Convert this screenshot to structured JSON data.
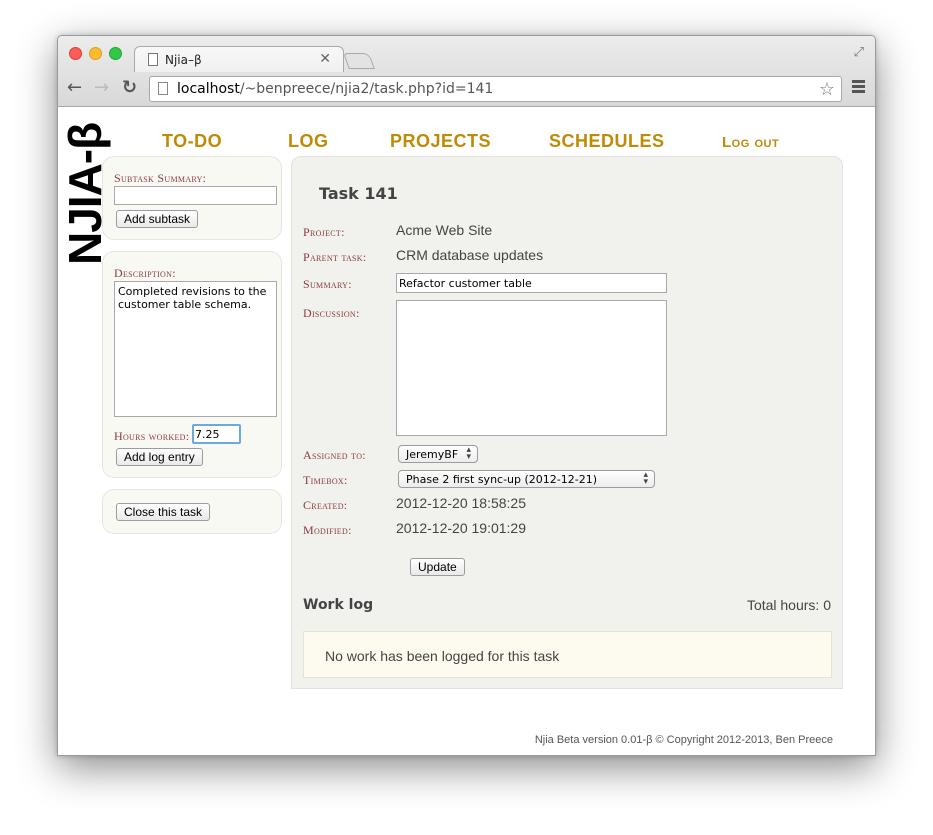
{
  "browser": {
    "tab_title": "Njia–β",
    "tab_close": "✕",
    "url_host": "localhost",
    "url_path": "/~benpreece/njia2/task.php?id=141"
  },
  "logo": {
    "text": "NJIA-β"
  },
  "nav": {
    "todo": "TO-DO",
    "log": "LOG",
    "projects": "PROJECTS",
    "schedules": "SCHEDULES",
    "logout": "Log out"
  },
  "subtask": {
    "label": "Subtask Summary:",
    "value": "",
    "add_button": "Add subtask"
  },
  "log_entry": {
    "description_label": "Description:",
    "description_value": "Completed revisions to the customer table schema.",
    "hours_label": "Hours worked:",
    "hours_value": "7.25",
    "add_button": "Add log entry"
  },
  "close_task": {
    "button": "Close this task"
  },
  "task": {
    "title": "Task 141",
    "project_label": "Project:",
    "project_value": "Acme Web Site",
    "parent_label": "Parent task:",
    "parent_value": "CRM database updates",
    "summary_label": "Summary:",
    "summary_value": "Refactor customer table",
    "discussion_label": "Discussion:",
    "discussion_value": "",
    "assigned_label": "Assigned to:",
    "assigned_value": "JeremyBF",
    "timebox_label": "Timebox:",
    "timebox_value": "Phase 2 first sync-up (2012-12-21)",
    "created_label": "Created:",
    "created_value": "2012-12-20 18:58:25",
    "modified_label": "Modified:",
    "modified_value": "2012-12-20 19:01:29",
    "update_button": "Update"
  },
  "worklog": {
    "title": "Work log",
    "total_hours": "Total hours: 0",
    "empty_message": "No work has been logged for this task"
  },
  "footer": {
    "text": "Njia Beta version 0.01-β © Copyright 2012-2013, Ben Preece"
  },
  "colors": {
    "nav": "#bf8a05",
    "label": "#8b3a3a",
    "panel": "#f1f1ed"
  }
}
